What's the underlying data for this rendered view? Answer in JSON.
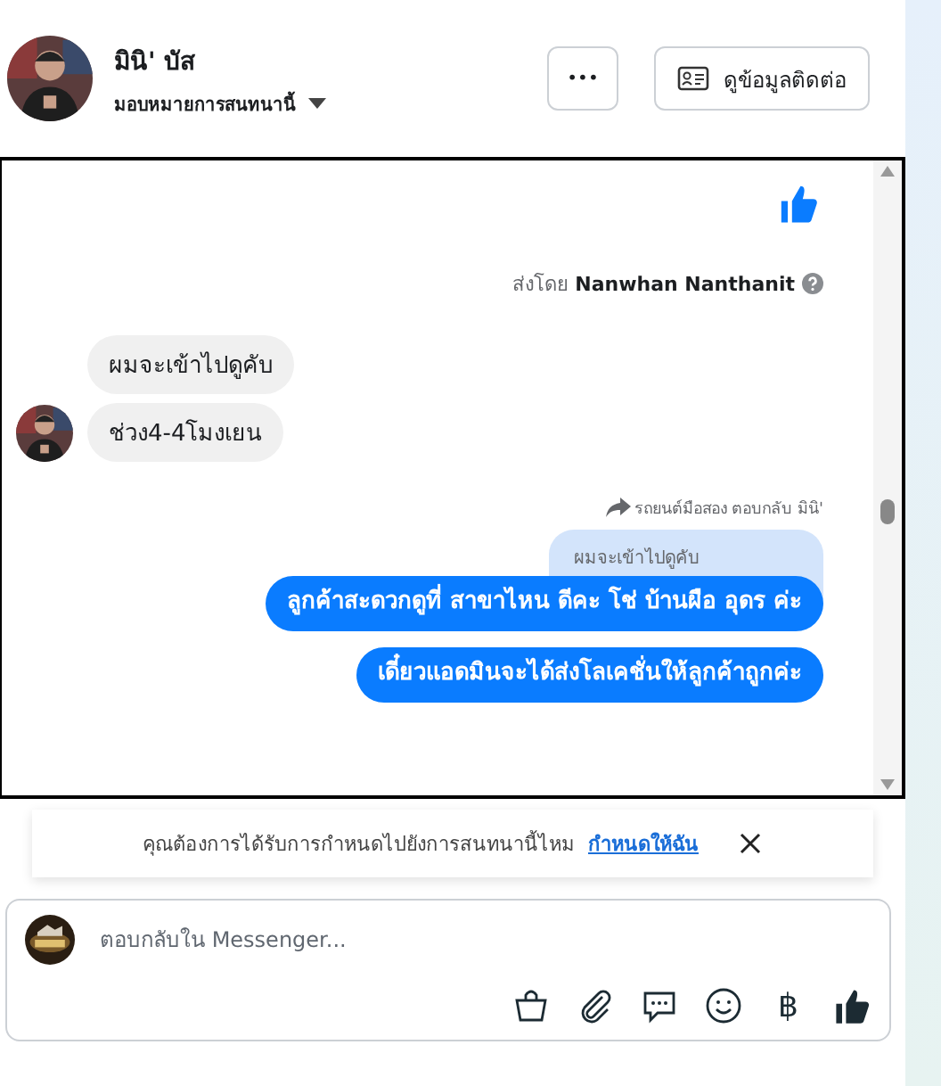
{
  "header": {
    "name": "มินิ' บัส",
    "assign_label": "มอบหมายการสนทนานี้",
    "more_button": "•••",
    "contact_button": "ดูข้อมูลติดต่อ"
  },
  "messages": [
    {
      "kind": "like"
    },
    {
      "kind": "sent_by",
      "prefix": "ส่งโดย",
      "name": "Nanwhan Nanthanit"
    },
    {
      "kind": "incoming",
      "text": "ผมจะเข้าไปดูคับ",
      "avatar": false
    },
    {
      "kind": "incoming",
      "text": "ช่วง4-4โมงเยน",
      "avatar": true
    },
    {
      "kind": "reply_note",
      "text": "รถยนต์มือสอง ตอบกลับ มินิ'"
    },
    {
      "kind": "quoted",
      "text": "ผมจะเข้าไปดูคับ"
    },
    {
      "kind": "outgoing",
      "text": "ลูกค้าสะดวกดูที่ สาขาไหน ดีคะ  โช่ บ้านผือ อุดร  ค่ะ"
    },
    {
      "kind": "outgoing",
      "text": "เดี๋ยวแอดมินจะได้ส่งโลเคชั่นให้ลูกค้าถูกค่ะ"
    }
  ],
  "banner": {
    "text": "คุณต้องการได้รับการกำหนดไปยังการสนทนานี้ไหม",
    "link": "กำหนดให้ฉัน"
  },
  "composer": {
    "placeholder": "ตอบกลับใน Messenger...",
    "tools": [
      {
        "kind": "bag"
      },
      {
        "kind": "clip"
      },
      {
        "kind": "chat"
      },
      {
        "kind": "emoji"
      },
      {
        "kind": "baht",
        "text": "฿"
      },
      {
        "kind": "like"
      }
    ]
  }
}
